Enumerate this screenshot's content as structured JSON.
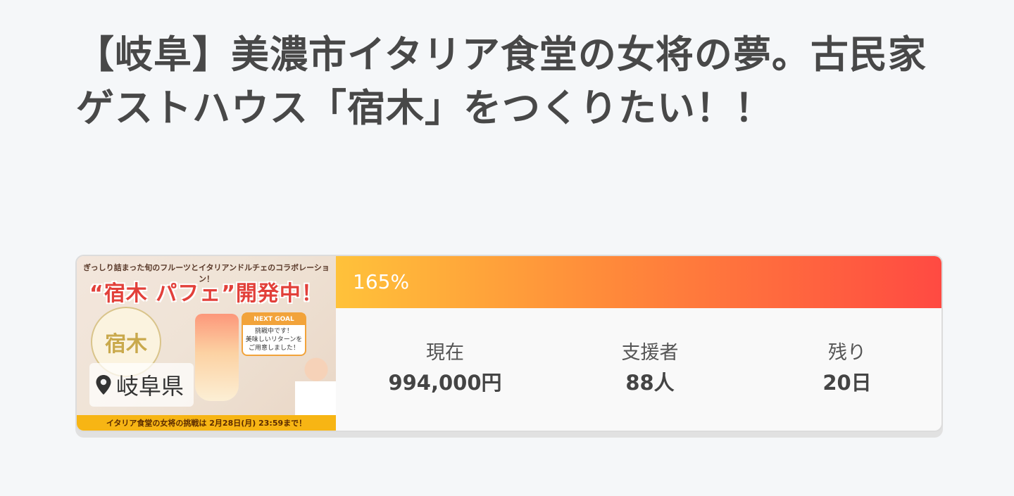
{
  "project": {
    "title": "【岐阜】美濃市イタリア食堂の女将の夢。古民家ゲストハウス「宿木」をつくりたい！！"
  },
  "thumbnail": {
    "promo_top": "ぎっしり詰まった旬のフルーツとイタリアンドルチェのコラボレーション！",
    "headline": "“宿木 パフェ”開発中！",
    "badge_text": "宿木",
    "goal_title": "NEXT GOAL",
    "goal_line1": "挑戦中です！",
    "goal_line2": "美味しいリターンをご用意しました！",
    "bottom_strip": "イタリア食堂の女将の挑戦は 2月28日(月) 23:59まで！",
    "location": "岐阜県"
  },
  "progress": {
    "percent_label": "165%",
    "fill_fraction": 1.0
  },
  "stats": [
    {
      "label": "現在",
      "value": "994,000円"
    },
    {
      "label": "支援者",
      "value": "88人"
    },
    {
      "label": "残り",
      "value": "20日"
    }
  ],
  "colors": {
    "background": "#f5f7f9",
    "progress_start": "#ffc23a",
    "progress_end": "#ff4a42",
    "text": "#444444"
  },
  "icons": {
    "location": "map-pin-icon"
  }
}
